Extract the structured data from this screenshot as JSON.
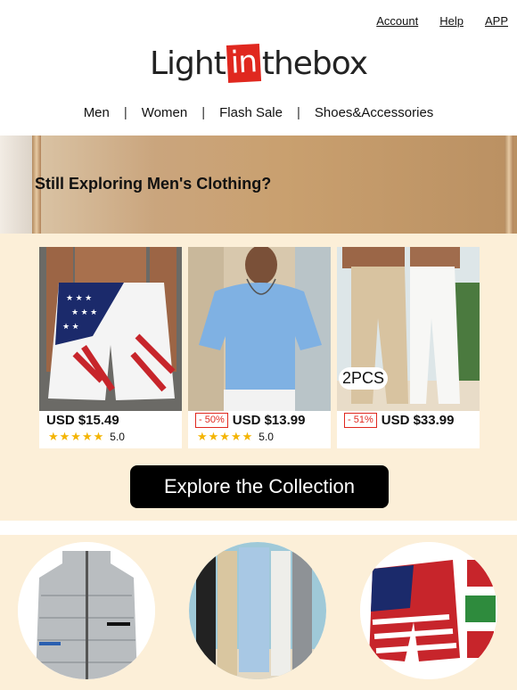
{
  "top_links": [
    "Account",
    "Help",
    "APP"
  ],
  "logo": {
    "part1": "Light",
    "part2": "in",
    "part3": "thebox"
  },
  "nav": [
    "Men",
    "Women",
    "Flash Sale",
    "Shoes&Accessories"
  ],
  "nav_separator": "|",
  "banner": {
    "headline": "Still Exploring Men's Clothing?"
  },
  "products": [
    {
      "price": "USD $15.49",
      "discount": "",
      "rating": "5.0",
      "stars": "★★★★★",
      "badge": ""
    },
    {
      "price": "USD $13.99",
      "discount": "- 50%",
      "rating": "5.0",
      "stars": "★★★★★",
      "badge": ""
    },
    {
      "price": "USD $33.99",
      "discount": "- 51%",
      "rating": "",
      "stars": "",
      "badge": "2PCS"
    }
  ],
  "cta": {
    "label": "Explore the Collection"
  },
  "colors": {
    "accent": "#e0281f",
    "cream": "#fcefd8",
    "star": "#f4b400"
  }
}
